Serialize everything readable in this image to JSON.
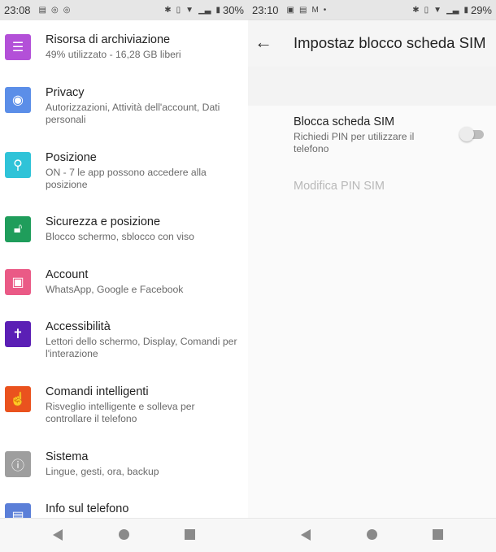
{
  "left": {
    "status": {
      "time": "23:08",
      "battery": "30%",
      "icons": [
        "notes-icon",
        "vpn-icon",
        "vpn-icon",
        "bluetooth-icon",
        "vibrate-icon",
        "wifi-icon",
        "signal-icon",
        "battery-icon"
      ]
    },
    "items": [
      {
        "title": "Risorsa di archiviazione",
        "subtitle": "49% utilizzato - 16,28 GB liberi",
        "icon": "storage-icon",
        "color": "#b350d8"
      },
      {
        "title": "Privacy",
        "subtitle": "Autorizzazioni, Attività dell'account, Dati personali",
        "icon": "privacy-eye-icon",
        "color": "#5b8ee8"
      },
      {
        "title": "Posizione",
        "subtitle": "ON - 7 le app possono accedere alla posizione",
        "icon": "location-pin-icon",
        "color": "#2fc3d8"
      },
      {
        "title": "Sicurezza e posizione",
        "subtitle": "Blocco schermo, sblocco con viso",
        "icon": "lock-open-icon",
        "color": "#1f9d5b"
      },
      {
        "title": "Account",
        "subtitle": "WhatsApp, Google e Facebook",
        "icon": "account-icon",
        "color": "#ea5a86"
      },
      {
        "title": "Accessibilità",
        "subtitle": "Lettori dello schermo, Display, Comandi per l'interazione",
        "icon": "accessibility-icon",
        "color": "#5b1fb5"
      },
      {
        "title": "Comandi intelligenti",
        "subtitle": "Risveglio intelligente e solleva per controllare il telefono",
        "icon": "hand-gesture-icon",
        "color": "#ea521e"
      },
      {
        "title": "Sistema",
        "subtitle": "Lingue, gesti, ora, backup",
        "icon": "info-circle-icon",
        "color": "#9e9e9e"
      },
      {
        "title": "Info sul telefono",
        "subtitle": "",
        "icon": "phone-info-icon",
        "color": "#5b7fd8"
      }
    ]
  },
  "right": {
    "status": {
      "time": "23:10",
      "battery": "29%",
      "icons": [
        "image-icon",
        "notes-icon",
        "gmail-icon",
        "dot-icon",
        "bluetooth-icon",
        "vibrate-icon",
        "wifi-icon",
        "signal-icon",
        "battery-icon"
      ]
    },
    "title": "Impostaz blocco scheda SIM",
    "lock_sim": {
      "title": "Blocca scheda SIM",
      "subtitle": "Richiedi PIN per utilizzare il telefono",
      "enabled": false
    },
    "change_pin": {
      "label": "Modifica PIN SIM",
      "disabled": true
    }
  }
}
